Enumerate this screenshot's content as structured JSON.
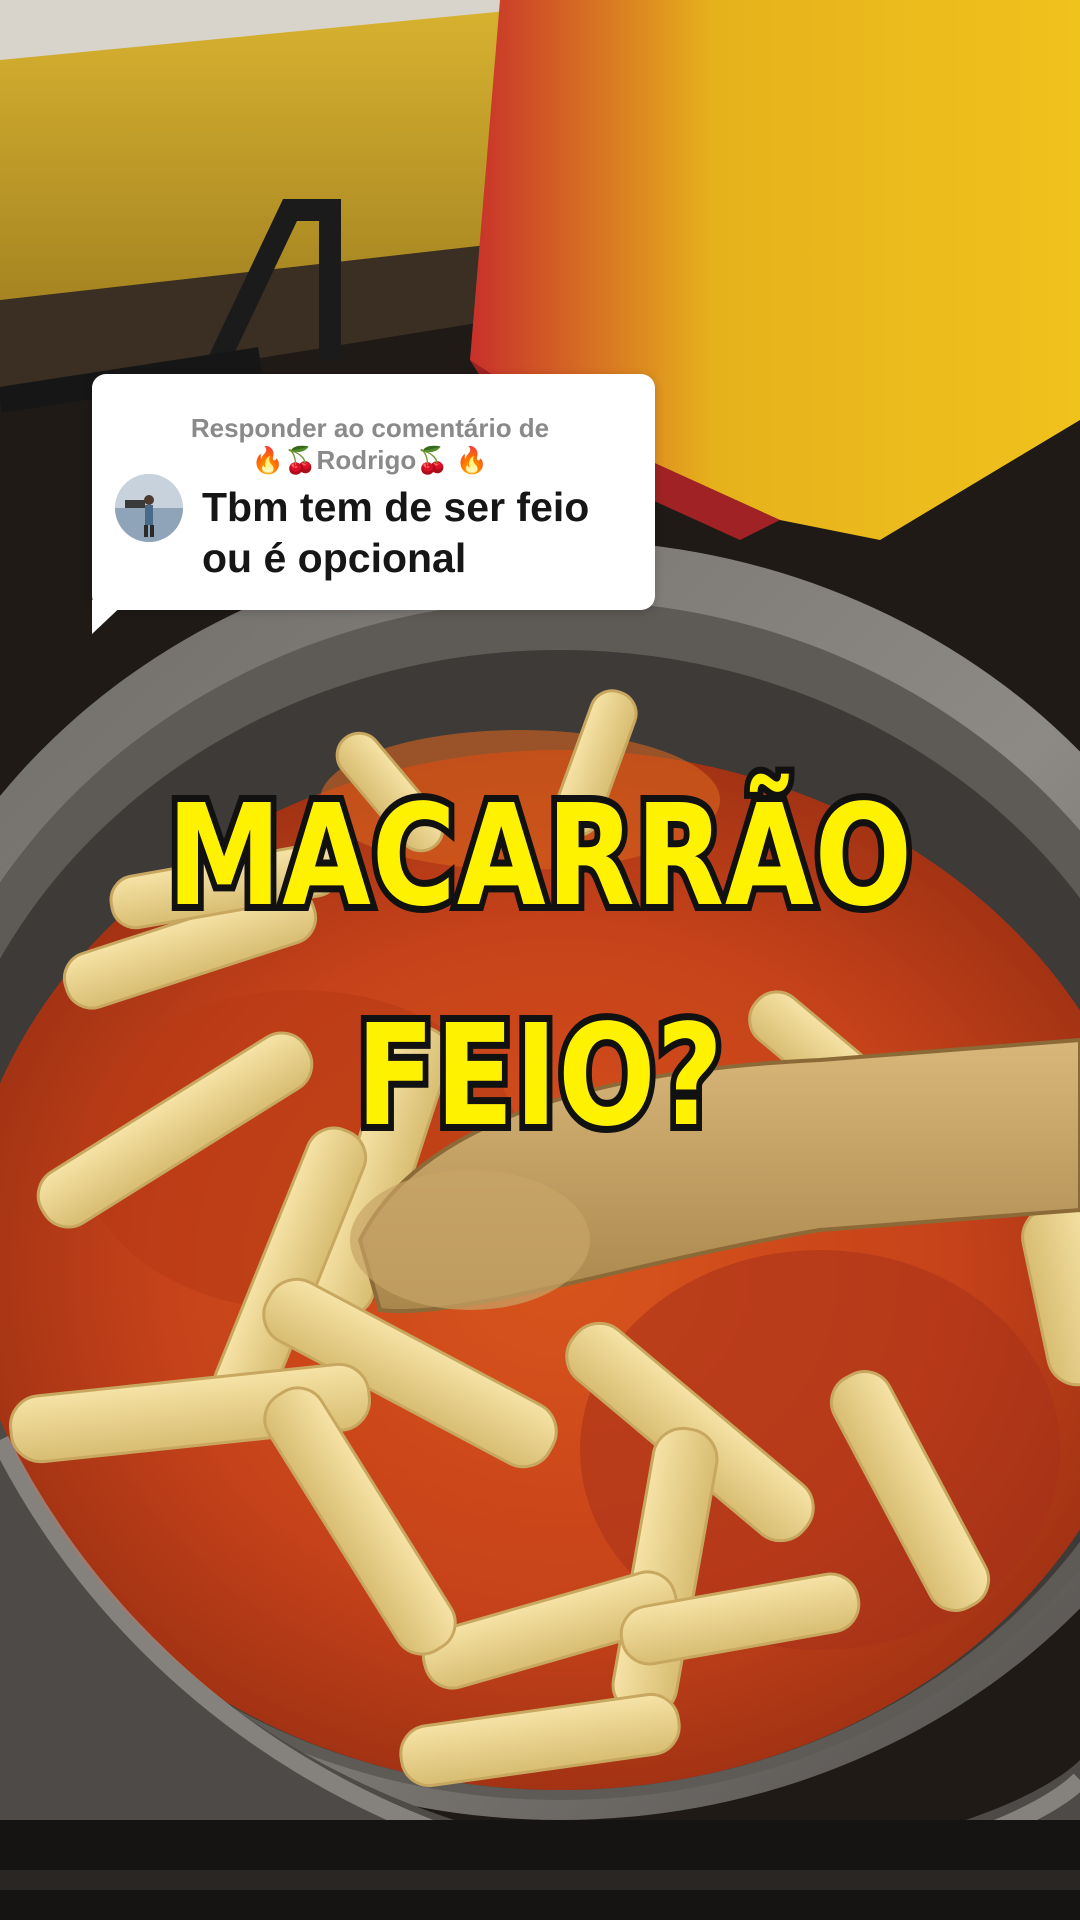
{
  "reply": {
    "header_line1": "Responder ao comentário de",
    "header_line2": "🔥🍒Rodrigo🍒 🔥",
    "comment": "Tbm tem de ser feio ou é opcional"
  },
  "overlay": {
    "line1": "MACARRÃO",
    "line2": "FEIO?"
  },
  "colors": {
    "overlay_text": "#fff200",
    "overlay_outline": "#111111",
    "bubble_bg": "#ffffff",
    "header_text": "#8a8a8a",
    "comment_text": "#161616"
  }
}
